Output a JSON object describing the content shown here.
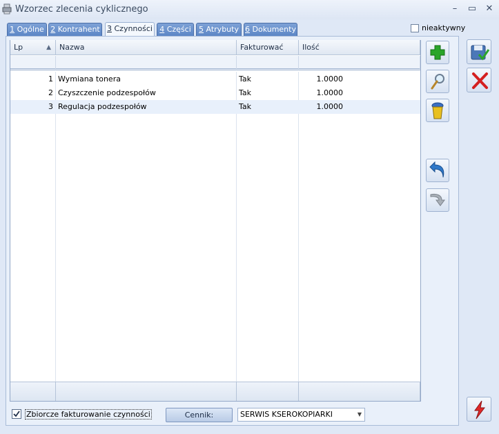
{
  "window": {
    "title": "Wzorzec zlecenia cyklicznego",
    "controls": [
      "–",
      "▭",
      "✕"
    ]
  },
  "tabs": [
    {
      "num": "1",
      "label": " Ogólne"
    },
    {
      "num": "2",
      "label": " Kontrahent"
    },
    {
      "num": "3",
      "label": " Czynności"
    },
    {
      "num": "4",
      "label": " Części"
    },
    {
      "num": "5",
      "label": " Atrybuty"
    },
    {
      "num": "6",
      "label": " Dokumenty"
    }
  ],
  "active_tab": "3 Czynności",
  "inactive_option": {
    "label": "nieaktywny",
    "checked": false
  },
  "grid": {
    "columns": [
      "Lp",
      "Nazwa",
      "Fakturować",
      "Ilość"
    ],
    "sort_indicator": "▲",
    "rows": [
      {
        "lp": "1",
        "nazwa": "Wymiana tonera",
        "fakturowac": "Tak",
        "ilosc": "1.0000"
      },
      {
        "lp": "2",
        "nazwa": "Czyszczenie podzespołów",
        "fakturowac": "Tak",
        "ilosc": "1.0000"
      },
      {
        "lp": "3",
        "nazwa": "Regulacja podzespołów",
        "fakturowac": "Tak",
        "ilosc": "1.0000"
      }
    ]
  },
  "side_buttons": [
    "add-icon",
    "edit-magnifier-icon",
    "delete-bin-icon",
    "move-up-icon",
    "move-down-icon"
  ],
  "right_buttons": [
    "save-icon",
    "cancel-icon",
    "lightning-icon"
  ],
  "bottom": {
    "zbiorcze_label": "Zbiorcze fakturowanie czynności",
    "zbiorcze_checked": true,
    "cennik_button": "Cennik:",
    "cennik_value": "SERWIS KSEROKOPIARKI"
  },
  "colors": {
    "tab_active_bg": "#f4f8fd",
    "tab_bg": "#6a93cd",
    "add_green": "#2aa52a",
    "cancel_red": "#d42020"
  }
}
